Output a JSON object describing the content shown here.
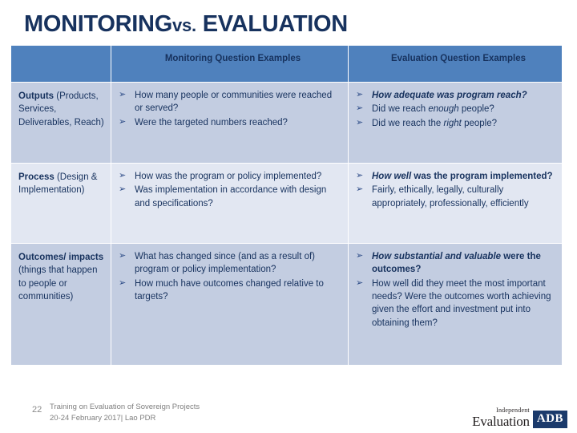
{
  "slide": {
    "title_main_1": "MONITORING",
    "title_vs": "vs.",
    "title_main_2": "EVALUATION",
    "accent_header_color": "#4F81BD",
    "text_color": "#17325E",
    "row_color_a": "#C3CDE1",
    "row_color_b": "#E2E7F2"
  },
  "table": {
    "headers": {
      "category": "",
      "monitoring": "Monitoring Question Examples",
      "evaluation": "Evaluation Question Examples"
    },
    "rows": [
      {
        "category_bold": "Outputs",
        "category_rest": "(Products, Services, Deliverables, Reach)",
        "monitoring": [
          "How many people or communities were reached or served?",
          "Were the targeted numbers reached?"
        ],
        "evaluation": [
          "How adequate was program reach?",
          " Did we reach enough people?",
          "Did we reach the right people?"
        ]
      },
      {
        "category_bold": "Process",
        "category_rest": "(Design & Implementation)",
        "monitoring": [
          "How was the program or policy implemented?",
          "Was implementation in accordance with design and specifications?"
        ],
        "evaluation": [
          "How well was the program implemented?",
          "Fairly, ethically, legally, culturally appropriately, professionally, efficiently"
        ]
      },
      {
        "category_bold": "Outcomes/ impacts",
        "category_rest": "(things that happen to people or communities)",
        "monitoring": [
          "What has changed since (and as a result of) program or policy implementation?",
          " How much have outcomes changed relative to targets?"
        ],
        "evaluation": [
          "How substantial and valuable were the outcomes?",
          "How well did they meet the most important needs? Were the outcomes worth achieving given the effort and investment put into obtaining them?"
        ]
      }
    ],
    "bullet_glyph": "➢"
  },
  "footer": {
    "page_number": "22",
    "line1": "Training on Evaluation of Sovereign Projects",
    "line2": "20-24 February 2017| Lao PDR",
    "logo_independent": "Independent",
    "logo_evaluation": "Evaluation",
    "logo_adb": "ADB",
    "logo_adb_color": "#1B3A6B"
  }
}
